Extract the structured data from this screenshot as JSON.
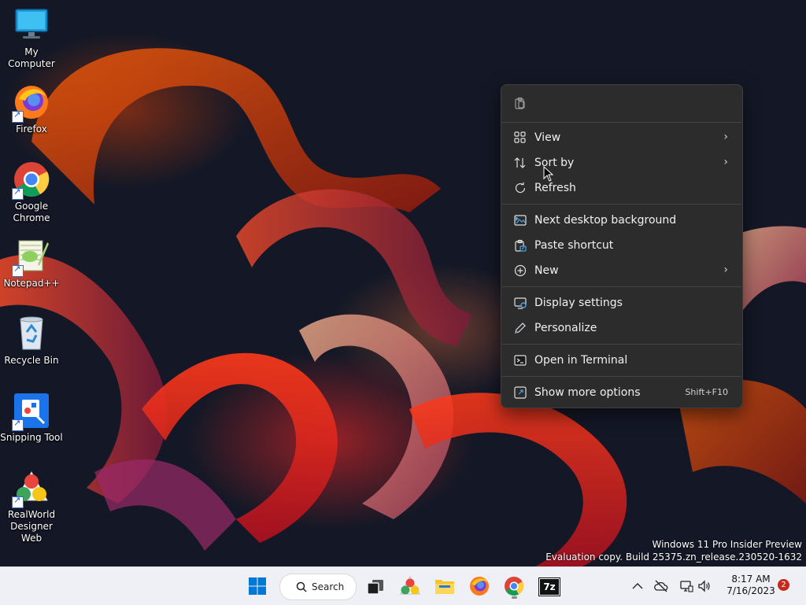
{
  "desktop": {
    "icons": [
      {
        "label": "My Computer",
        "icon": "monitor-icon"
      },
      {
        "label": "Firefox",
        "icon": "firefox-icon"
      },
      {
        "label": "Google Chrome",
        "icon": "chrome-icon"
      },
      {
        "label": "Notepad++",
        "icon": "notepadpp-icon"
      },
      {
        "label": "Recycle Bin",
        "icon": "recycle-bin-icon"
      },
      {
        "label": "Snipping Tool",
        "icon": "snipping-tool-icon"
      },
      {
        "label": "RealWorld Designer Web",
        "icon": "realworld-icon"
      }
    ],
    "watermark": {
      "line1": "Windows 11 Pro Insider Preview",
      "line2": "Evaluation copy. Build 25375.zn_release.230520-1632"
    }
  },
  "context_menu": {
    "top_action_icon": "clipboard-icon",
    "items": [
      {
        "label": "View",
        "icon": "grid-icon",
        "submenu": true
      },
      {
        "label": "Sort by",
        "icon": "sort-icon",
        "submenu": true
      },
      {
        "label": "Refresh",
        "icon": "refresh-icon",
        "submenu": false
      },
      {
        "label": "Next desktop background",
        "icon": "next-background-icon",
        "submenu": false
      },
      {
        "label": "Paste shortcut",
        "icon": "paste-shortcut-icon",
        "submenu": false
      },
      {
        "label": "New",
        "icon": "new-plus-icon",
        "submenu": true
      },
      {
        "label": "Display settings",
        "icon": "display-settings-icon",
        "submenu": false
      },
      {
        "label": "Personalize",
        "icon": "pen-icon",
        "submenu": false
      },
      {
        "label": "Open in Terminal",
        "icon": "terminal-icon",
        "submenu": false
      },
      {
        "label": "Show more options",
        "icon": "more-options-icon",
        "shortcut": "Shift+F10"
      }
    ]
  },
  "taskbar": {
    "search_label": "Search",
    "apps": [
      "start-icon",
      "search-icon",
      "task-view-icon",
      "realworld-icon",
      "file-explorer-icon",
      "firefox-icon",
      "chrome-icon",
      "7zip-icon"
    ],
    "sevenzip_text": "7z",
    "tray": {
      "icons": [
        "chevron-up-icon",
        "cloud-off-icon",
        "network-icon",
        "volume-icon"
      ],
      "time": "8:17 AM",
      "date": "7/16/2023",
      "notification_count": "2"
    }
  },
  "colors": {
    "menu_bg": "#2c2c2c",
    "taskbar_bg": "#eef0f5",
    "accent": "#0078d4",
    "badge": "#c42b1c"
  }
}
